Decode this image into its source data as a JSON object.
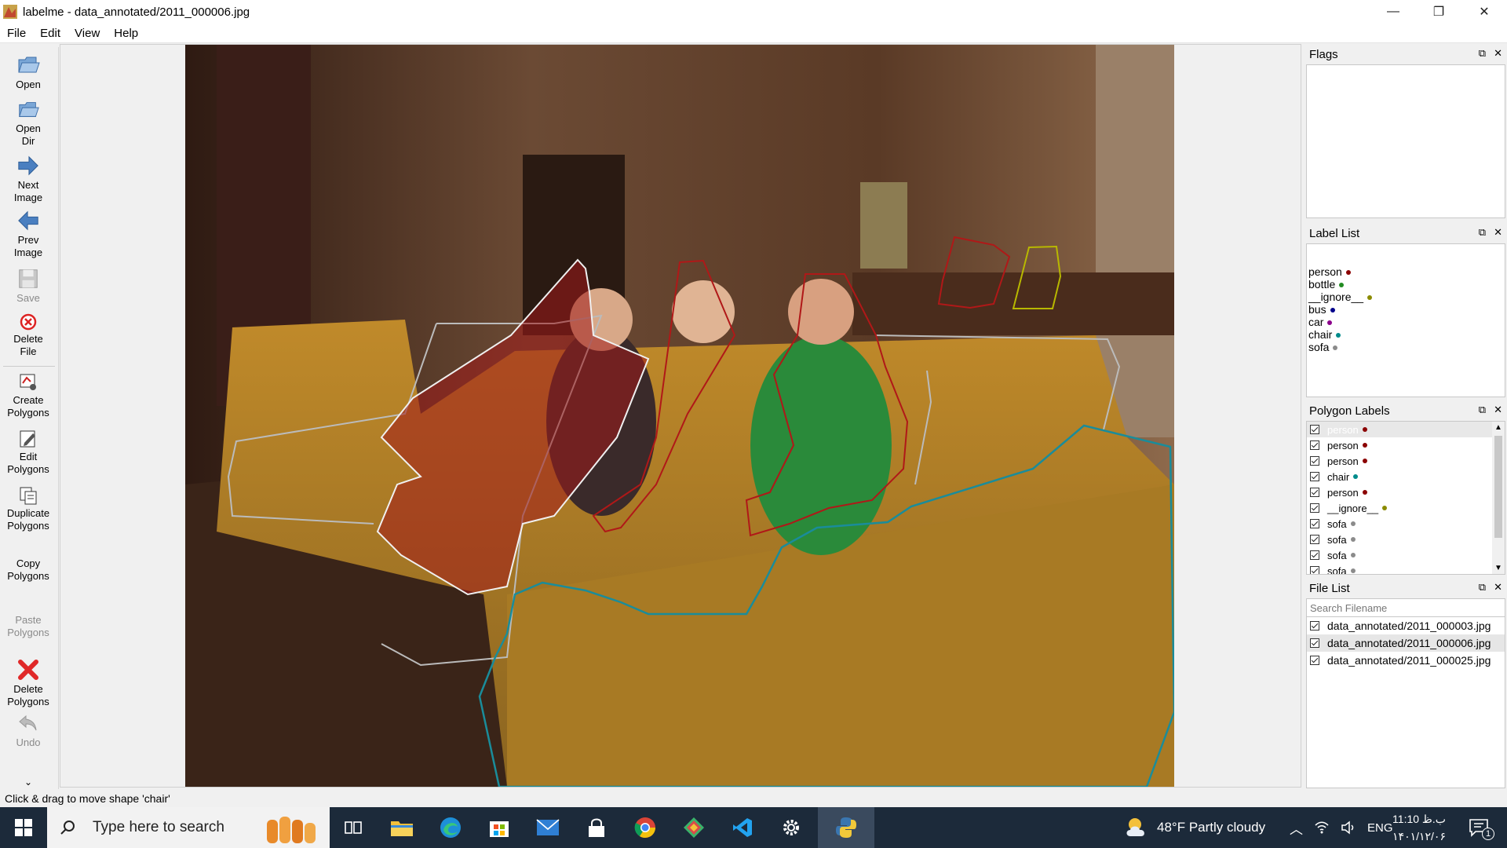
{
  "window": {
    "title": "labelme - data_annotated/2011_000006.jpg",
    "minimize": "—",
    "restore": "❐",
    "close": "✕"
  },
  "menu": [
    "File",
    "Edit",
    "View",
    "Help"
  ],
  "toolbar": {
    "open": "Open",
    "open_dir_1": "Open",
    "open_dir_2": "Dir",
    "next_1": "Next",
    "next_2": "Image",
    "prev_1": "Prev",
    "prev_2": "Image",
    "save": "Save",
    "delete_file_1": "Delete",
    "delete_file_2": "File",
    "create_1": "Create",
    "create_2": "Polygons",
    "edit_1": "Edit",
    "edit_2": "Polygons",
    "duplicate_1": "Duplicate",
    "duplicate_2": "Polygons",
    "copy_1": "Copy",
    "copy_2": "Polygons",
    "paste_1": "Paste",
    "paste_2": "Polygons",
    "delete_poly_1": "Delete",
    "delete_poly_2": "Polygons",
    "undo": "Undo",
    "more": "⌄"
  },
  "flags": {
    "title": "Flags"
  },
  "label_list": {
    "title": "Label List",
    "items": [
      {
        "label": "person",
        "color": "#8b0000"
      },
      {
        "label": "bottle",
        "color": "#228b22"
      },
      {
        "label": "__ignore__",
        "color": "#8b8b00"
      },
      {
        "label": "bus",
        "color": "#00008b"
      },
      {
        "label": "car",
        "color": "#8b008b"
      },
      {
        "label": "chair",
        "color": "#008b8b"
      },
      {
        "label": "sofa",
        "color": "#8b8b8b"
      }
    ]
  },
  "polygon_labels": {
    "title": "Polygon Labels",
    "items": [
      {
        "label": "person",
        "color": "#8b0000",
        "selected": true
      },
      {
        "label": "person",
        "color": "#8b0000"
      },
      {
        "label": "person",
        "color": "#8b0000"
      },
      {
        "label": "chair",
        "color": "#008b8b"
      },
      {
        "label": "person",
        "color": "#8b0000"
      },
      {
        "label": "__ignore__",
        "color": "#8b8b00"
      },
      {
        "label": "sofa",
        "color": "#8b8b8b"
      },
      {
        "label": "sofa",
        "color": "#8b8b8b"
      },
      {
        "label": "sofa",
        "color": "#8b8b8b"
      },
      {
        "label": "sofa",
        "color": "#8b8b8b"
      }
    ]
  },
  "file_list": {
    "title": "File List",
    "search_placeholder": "Search Filename",
    "files": [
      {
        "name": "data_annotated/2011_000003.jpg"
      },
      {
        "name": "data_annotated/2011_000006.jpg",
        "selected": true
      },
      {
        "name": "data_annotated/2011_000025.jpg"
      }
    ]
  },
  "status": "Click & drag to move shape 'chair'",
  "taskbar": {
    "search_placeholder": "Type here to search",
    "weather": "48°F  Partly cloudy",
    "lang": "ENG",
    "time": "11:10 ب.ظ",
    "date": "۱۴۰۱/۱۲/۰۶",
    "notification_count": "1"
  }
}
